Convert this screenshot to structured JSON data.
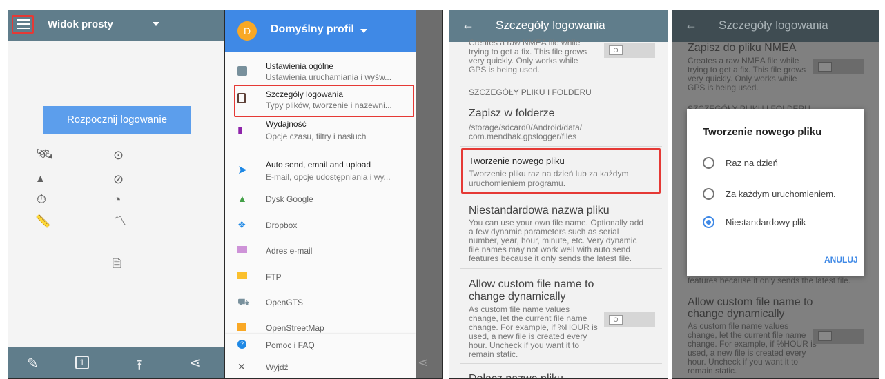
{
  "panel1": {
    "title": "Widok prosty",
    "menu_icon": "hamburger-menu-icon",
    "start_button": "Rozpocznij logowanie",
    "status_icons": [
      "satellite-icon",
      "gps-fix-icon",
      "terrain-icon",
      "compass-icon",
      "timer-icon",
      "speed-icon",
      "ruler-icon",
      "route-icon",
      "file-icon"
    ],
    "bottom_icons": [
      "pencil-icon",
      "one-icon",
      "upload-icon",
      "share-icon"
    ]
  },
  "panel2": {
    "avatar": "D",
    "profile": "Domyślny profil",
    "items": [
      {
        "title": "Ustawienia ogólne",
        "sub": "Ustawienia uruchamiania i wyśw..."
      },
      {
        "title": "Szczegóły logowania",
        "sub": "Typy plików, tworzenie i nazewni..."
      },
      {
        "title": "Wydajność",
        "sub": "Opcje czasu, filtry i nasłuch"
      },
      {
        "title": "Auto send, email and upload",
        "sub": "E-mail, opcje udostępniania i wy..."
      },
      {
        "title": "Dysk Google",
        "sub": ""
      },
      {
        "title": "Dropbox",
        "sub": ""
      },
      {
        "title": "Adres e-mail",
        "sub": ""
      },
      {
        "title": "FTP",
        "sub": ""
      },
      {
        "title": "OpenGTS",
        "sub": ""
      },
      {
        "title": "OpenStreetMap",
        "sub": ""
      },
      {
        "title": "Pomoc i FAQ",
        "sub": ""
      },
      {
        "title": "Wyjdź",
        "sub": ""
      }
    ]
  },
  "panel3": {
    "title": "Szczegóły logowania",
    "nmea_text": [
      "Creates a raw NMEA file while",
      "trying to get a fix. This file grows",
      "very quickly. Only works while",
      "GPS is being used."
    ],
    "section_header": "SZCZEGÓŁY PLIKU I FOLDERU",
    "folder_title": "Zapisz w folderze",
    "folder_path": [
      "/storage/sdcard0/Android/data/",
      "com.mendhak.gpslogger/files"
    ],
    "new_file_title": "Tworzenie nowego pliku",
    "new_file_sub": [
      "Tworzenie pliku raz na dzień lub za każdym",
      "uruchomieniem programu."
    ],
    "custom_name_title": "Niestandardowa nazwa pliku",
    "custom_name_sub": [
      "You can use your own file name. Optionally add",
      "a few dynamic parameters such as serial",
      "number, year, hour, minute, etc. Very dynamic",
      "file names may not work well with auto send",
      "features because it only sends the latest file."
    ],
    "dynamic_title": [
      "Allow custom file name to",
      "change dynamically"
    ],
    "dynamic_sub": [
      "As custom file name values",
      "change, let the current file name",
      "change. For example, if %HOUR is",
      "used, a new file is created every",
      "hour. Uncheck if you want it to",
      "remain static."
    ],
    "cut_text": "Dołącz nazwę pliku"
  },
  "panel4": {
    "title": "Szczegóły logowania",
    "nmea_title": "Zapisz do pliku NMEA",
    "nmea_text": [
      "Creates a raw NMEA file while",
      "trying to get a fix. This file grows",
      "very quickly. Only works while",
      "GPS is being used."
    ],
    "section_header": "SZCZEGÓŁY PLIKU I FOLDERU",
    "behind_text": "features because it only sends the latest file.",
    "dynamic_title": [
      "Allow custom file name to",
      "change dynamically"
    ],
    "dynamic_sub": [
      "As custom file name values",
      "change, let the current file name",
      "change. For example, if %HOUR is",
      "used, a new file is created every",
      "hour. Uncheck if you want it to",
      "remain static."
    ],
    "dialog": {
      "title": "Tworzenie nowego pliku",
      "options": [
        {
          "label": "Raz na dzień",
          "selected": false
        },
        {
          "label": "Za każdym uruchomieniem.",
          "selected": false
        },
        {
          "label": "Niestandardowy plik",
          "selected": true
        }
      ],
      "cancel": "ANULUJ"
    }
  }
}
